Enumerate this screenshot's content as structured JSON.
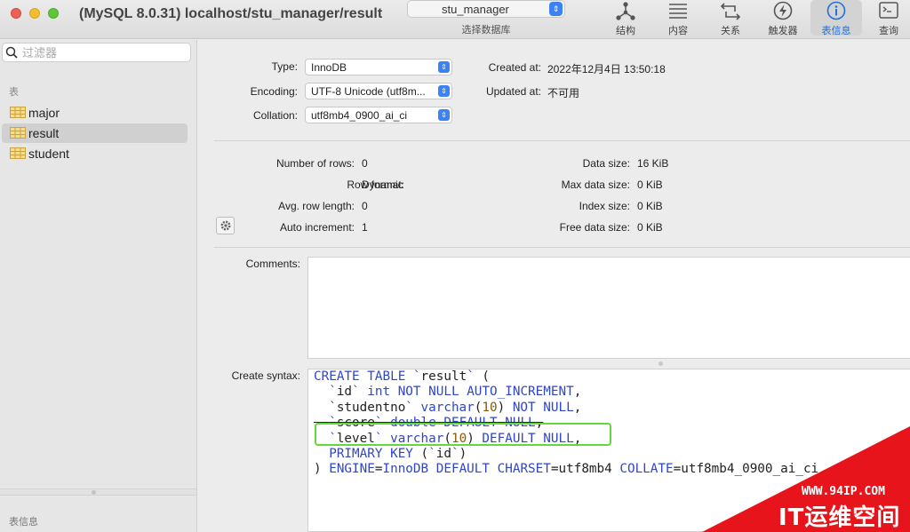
{
  "window": {
    "title": "(MySQL 8.0.31) localhost/stu_manager/result",
    "traffic_lights": [
      "close",
      "minimize",
      "zoom"
    ]
  },
  "toolbar": {
    "database_selector": {
      "value": "stu_manager",
      "label": "选择数据库"
    },
    "buttons": [
      {
        "label": "结构",
        "icon": "structure-icon"
      },
      {
        "label": "内容",
        "icon": "content-icon"
      },
      {
        "label": "关系",
        "icon": "relations-icon"
      },
      {
        "label": "触发器",
        "icon": "triggers-icon"
      },
      {
        "label": "表信息",
        "icon": "info-icon",
        "active": true
      },
      {
        "label": "查询",
        "icon": "query-icon"
      }
    ],
    "active_color": "#1f6fe0"
  },
  "sidebar": {
    "filter_placeholder": "过滤器",
    "section_title": "表",
    "tables": [
      {
        "name": "major",
        "selected": false
      },
      {
        "name": "result",
        "selected": true
      },
      {
        "name": "student",
        "selected": false
      }
    ],
    "footer_title": "表信息"
  },
  "table_info": {
    "type": {
      "label": "Type:",
      "value": "InnoDB"
    },
    "encoding": {
      "label": "Encoding:",
      "value": "UTF-8 Unicode (utf8m..."
    },
    "collation": {
      "label": "Collation:",
      "value": "utf8mb4_0900_ai_ci"
    },
    "created_at": {
      "label": "Created at:",
      "value": "2022年12月4日 13:50:18"
    },
    "updated_at": {
      "label": "Updated at:",
      "value": "不可用"
    },
    "stats_left": [
      {
        "label": "Number of rows:",
        "value": "0"
      },
      {
        "label": "Row format:",
        "value": "Dynamic"
      },
      {
        "label": "Avg. row length:",
        "value": "0"
      },
      {
        "label": "Auto increment:",
        "value": "1"
      }
    ],
    "stats_right": [
      {
        "label": "Data size:",
        "value": "16 KiB"
      },
      {
        "label": "Max data size:",
        "value": "0 KiB"
      },
      {
        "label": "Index size:",
        "value": "0 KiB"
      },
      {
        "label": "Free data size:",
        "value": "0 KiB"
      }
    ],
    "comments_label": "Comments:",
    "comments_value": "",
    "syntax_label": "Create syntax:",
    "syntax_lines": [
      "CREATE TABLE `result` (",
      "  `id` int NOT NULL AUTO_INCREMENT,",
      "  `studentno` varchar(10) NOT NULL,",
      "  `score` double DEFAULT NULL,",
      "  `level` varchar(10) DEFAULT NULL,",
      "  PRIMARY KEY (`id`)",
      ") ENGINE=InnoDB DEFAULT CHARSET=utf8mb4 COLLATE=utf8mb4_0900_ai_ci"
    ],
    "highlight_color": "#62d83a"
  },
  "watermark": {
    "url": "WWW.94IP.COM",
    "name": "IT运维空间",
    "color": "#e8141b"
  }
}
